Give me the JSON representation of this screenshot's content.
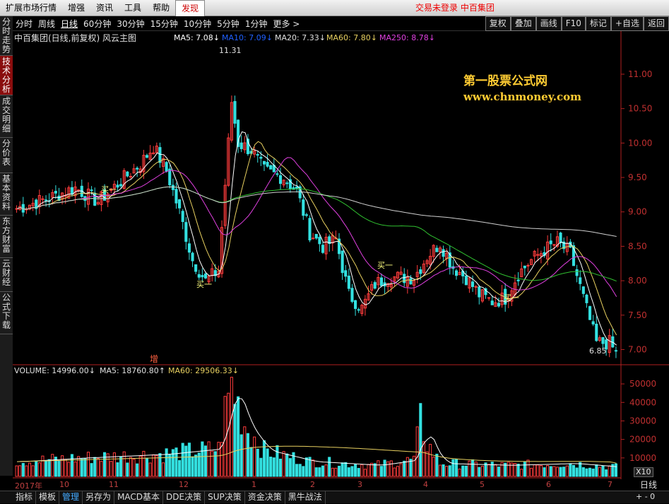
{
  "menubar": {
    "items": [
      {
        "label": "扩展市场行情"
      },
      {
        "label": "增强"
      },
      {
        "label": "资讯"
      },
      {
        "label": "工具"
      },
      {
        "label": "帮助"
      },
      {
        "label": "发现"
      }
    ],
    "status_text": "交易未登录   中百集团"
  },
  "periods": [
    "分时",
    "周线",
    "日线",
    "60分钟",
    "30分钟",
    "15分钟",
    "10分钟",
    "5分钟",
    "1分钟",
    "更多 >"
  ],
  "right_buttons": [
    "复权",
    "叠加",
    "画线",
    "F10",
    "标记",
    "+自选",
    "返回"
  ],
  "side_tabs": [
    "分时走势",
    "技术分析",
    "成交明细",
    "分价表",
    "基本资料",
    "东方财富",
    "云财经",
    "公式下载"
  ],
  "chart_title": "中百集团(日线,前复权) 风云主图",
  "ma_legend": {
    "ma5": "MA5: 7.08↓",
    "ma10": "MA10: 7.09↓",
    "ma20": "MA20: 7.33↓",
    "ma60": "MA60: 7.80↓",
    "ma250": "MA250: 8.78↓"
  },
  "vol_legend": {
    "vol": "VOLUME: 14996.00↓",
    "ma5": "MA5: 18760.80↑",
    "ma60": "MA60: 29506.33↓"
  },
  "watermark": {
    "line1": "第一股票公式网",
    "line2": "www.chnmoney.com"
  },
  "annotations": {
    "high": "11.31",
    "low": "6.85",
    "buy": "买一",
    "zeng": "增"
  },
  "dates": [
    "2017年",
    "10",
    "11",
    "12",
    "1",
    "2",
    "3",
    "4",
    "5",
    "6",
    "7"
  ],
  "bottom_tabs": [
    "指标",
    "模板",
    "管理",
    "另存为",
    "MACD基本",
    "DDE决策",
    "SUP决策",
    "资金决策",
    "黑牛战法"
  ],
  "bottom_right": {
    "period": "日线",
    "zoom": "+ - 0",
    "x10": "X10"
  },
  "colors": {
    "up": "#ff3c3c",
    "down": "#33e0e0",
    "ma5": "#ffffff",
    "ma10": "#e8d060",
    "ma20": "#e040e0",
    "ma60": "#30c030",
    "ma250": "#d0d0d0",
    "ma10_legend": "#2060ff",
    "axis": "#b02020"
  },
  "chart_data": {
    "type": "candlestick",
    "title": "中百集团(日线,前复权) 风云主图",
    "price_ylim": [
      6.8,
      11.4
    ],
    "price_ticks": [
      7.0,
      7.5,
      8.0,
      8.5,
      9.0,
      9.5,
      10.0,
      10.5,
      11.0
    ],
    "volume_ylim": [
      0,
      55000
    ],
    "volume_ticks": [
      10000,
      20000,
      30000,
      40000,
      50000
    ],
    "x_labels": [
      "2017年",
      "10",
      "11",
      "12",
      "1",
      "2",
      "3",
      "4",
      "5",
      "6",
      "7"
    ],
    "close_anchors": [
      [
        0,
        9.05
      ],
      [
        10,
        9.2
      ],
      [
        18,
        9.35
      ],
      [
        25,
        9.15
      ],
      [
        32,
        9.45
      ],
      [
        38,
        9.7
      ],
      [
        42,
        9.95
      ],
      [
        46,
        9.6
      ],
      [
        50,
        9.0
      ],
      [
        54,
        8.3
      ],
      [
        58,
        8.0
      ],
      [
        62,
        8.15
      ],
      [
        64,
        9.4
      ],
      [
        66,
        10.6
      ],
      [
        68,
        10.0
      ],
      [
        72,
        9.9
      ],
      [
        76,
        9.6
      ],
      [
        82,
        9.5
      ],
      [
        86,
        9.3
      ],
      [
        90,
        8.7
      ],
      [
        94,
        8.5
      ],
      [
        98,
        8.6
      ],
      [
        102,
        7.8
      ],
      [
        106,
        7.6
      ],
      [
        110,
        7.95
      ],
      [
        114,
        8.05
      ],
      [
        118,
        8.05
      ],
      [
        122,
        8.05
      ],
      [
        126,
        8.35
      ],
      [
        130,
        8.55
      ],
      [
        134,
        8.2
      ],
      [
        138,
        8.05
      ],
      [
        142,
        7.8
      ],
      [
        146,
        7.7
      ],
      [
        150,
        7.75
      ],
      [
        154,
        8.1
      ],
      [
        158,
        8.3
      ],
      [
        162,
        8.45
      ],
      [
        166,
        8.55
      ],
      [
        170,
        8.4
      ],
      [
        174,
        7.75
      ],
      [
        178,
        7.1
      ],
      [
        182,
        7.1
      ],
      [
        184,
        6.95
      ]
    ],
    "volume_anchors": [
      [
        0,
        8000
      ],
      [
        20,
        10000
      ],
      [
        45,
        12000
      ],
      [
        62,
        15000
      ],
      [
        64,
        35000
      ],
      [
        66,
        50000
      ],
      [
        70,
        28000
      ],
      [
        76,
        14000
      ],
      [
        90,
        8000
      ],
      [
        110,
        6000
      ],
      [
        122,
        9000
      ],
      [
        124,
        30000
      ],
      [
        126,
        18000
      ],
      [
        130,
        7000
      ],
      [
        150,
        6000
      ],
      [
        170,
        7000
      ],
      [
        184,
        5000
      ]
    ]
  }
}
